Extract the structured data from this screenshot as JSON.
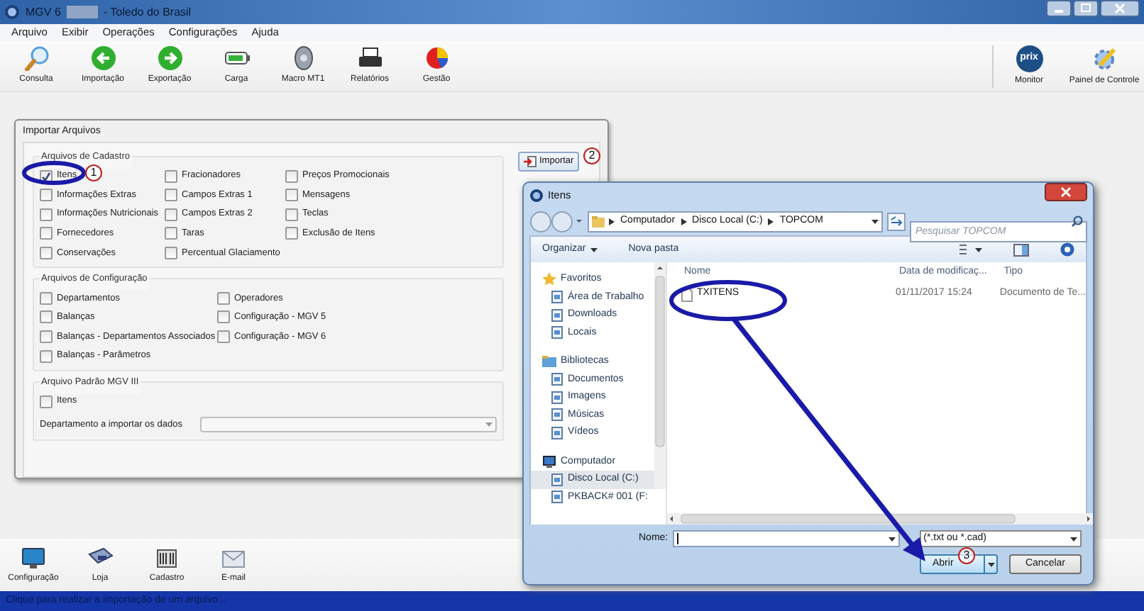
{
  "window": {
    "title": "MGV 6",
    "title_suffix": "- Toledo do Brasil"
  },
  "menu": [
    "Arquivo",
    "Exibir",
    "Operações",
    "Configurações",
    "Ajuda"
  ],
  "toolbar": [
    {
      "label": "Consulta"
    },
    {
      "label": "Importação"
    },
    {
      "label": "Exportação"
    },
    {
      "label": "Carga"
    },
    {
      "label": "Macro MT1"
    },
    {
      "label": "Relatórios"
    },
    {
      "label": "Gestão"
    }
  ],
  "toolbar_right": [
    {
      "label": "Monitor",
      "logo_text": "prix"
    },
    {
      "label": "Painel de Controle"
    }
  ],
  "import_panel": {
    "title": "Importar Arquivos",
    "import_button": "Importar",
    "groups": [
      {
        "title": "Arquivos de Cadastro",
        "columns": [
          [
            {
              "label": "Itens",
              "checked": true
            },
            {
              "label": "Informações Extras",
              "checked": false
            },
            {
              "label": "Informações Nutricionais",
              "checked": false
            },
            {
              "label": "Fornecedores",
              "checked": false
            },
            {
              "label": "Conservações",
              "checked": false
            }
          ],
          [
            {
              "label": "Fracionadores",
              "checked": false
            },
            {
              "label": "Campos Extras 1",
              "checked": false
            },
            {
              "label": "Campos Extras 2",
              "checked": false
            },
            {
              "label": "Taras",
              "checked": false
            },
            {
              "label": "Percentual Glaciamento",
              "checked": false
            }
          ],
          [
            {
              "label": "Preços Promocionais",
              "checked": false
            },
            {
              "label": "Mensagens",
              "checked": false
            },
            {
              "label": "Teclas",
              "checked": false
            },
            {
              "label": "Exclusão de Itens",
              "checked": false
            }
          ]
        ]
      },
      {
        "title": "Arquivos de Configuração",
        "columns": [
          [
            {
              "label": "Departamentos",
              "checked": false
            },
            {
              "label": "Balanças",
              "checked": false
            },
            {
              "label": "Balanças - Departamentos Associados",
              "checked": false
            },
            {
              "label": "Balanças - Parâmetros",
              "checked": false
            }
          ],
          [
            {
              "label": "Operadores",
              "checked": false
            },
            {
              "label": "Configuração - MGV 5",
              "checked": false
            },
            {
              "label": "Configuração - MGV 6",
              "checked": false
            }
          ]
        ]
      },
      {
        "title": "Arquivo Padrão MGV III",
        "columns": [
          [
            {
              "label": "Itens",
              "checked": false
            }
          ]
        ]
      }
    ],
    "department_label": "Departamento a importar os dados"
  },
  "dialog": {
    "title": "Itens",
    "breadcrumb": [
      "Computador",
      "Disco Local (C:)",
      "TOPCOM"
    ],
    "search": {
      "placeholder": "Pesquisar TOPCOM"
    },
    "commands": [
      "Organizar",
      "Nova pasta"
    ],
    "nav": [
      {
        "label": "Favoritos",
        "selected": false,
        "children": [
          {
            "label": "Área de Trabalho",
            "selected": false
          },
          {
            "label": "Downloads",
            "selected": false
          },
          {
            "label": "Locais",
            "selected": false
          }
        ]
      },
      {
        "label": "Bibliotecas",
        "selected": false,
        "children": [
          {
            "label": "Documentos",
            "selected": false
          },
          {
            "label": "Imagens",
            "selected": false
          },
          {
            "label": "Músicas",
            "selected": false
          },
          {
            "label": "Vídeos",
            "selected": false
          }
        ]
      },
      {
        "label": "Computador",
        "selected": false,
        "children": [
          {
            "label": "Disco Local (C:)",
            "selected": true
          },
          {
            "label": "PKBACK# 001 (F:",
            "selected": false
          }
        ]
      }
    ],
    "columns": [
      "Nome",
      "Data de modificaç...",
      "Tipo"
    ],
    "files": [
      {
        "name": "TXITENS",
        "date": "01/11/2017 15:24",
        "type": "Documento de Te..."
      }
    ],
    "filename_label": "Nome:",
    "filter": "(*.txt ou *.cad)",
    "buttons": [
      "Abrir",
      "Cancelar"
    ]
  },
  "bottom_toolbar": [
    {
      "label": "Configuração"
    },
    {
      "label": "Loja"
    },
    {
      "label": "Cadastro"
    },
    {
      "label": "E-mail"
    }
  ],
  "status_bar": "Clique para realizar a importação de um arquivo...",
  "annotations": [
    {
      "label": "1"
    },
    {
      "label": "2"
    },
    {
      "label": "3"
    }
  ]
}
